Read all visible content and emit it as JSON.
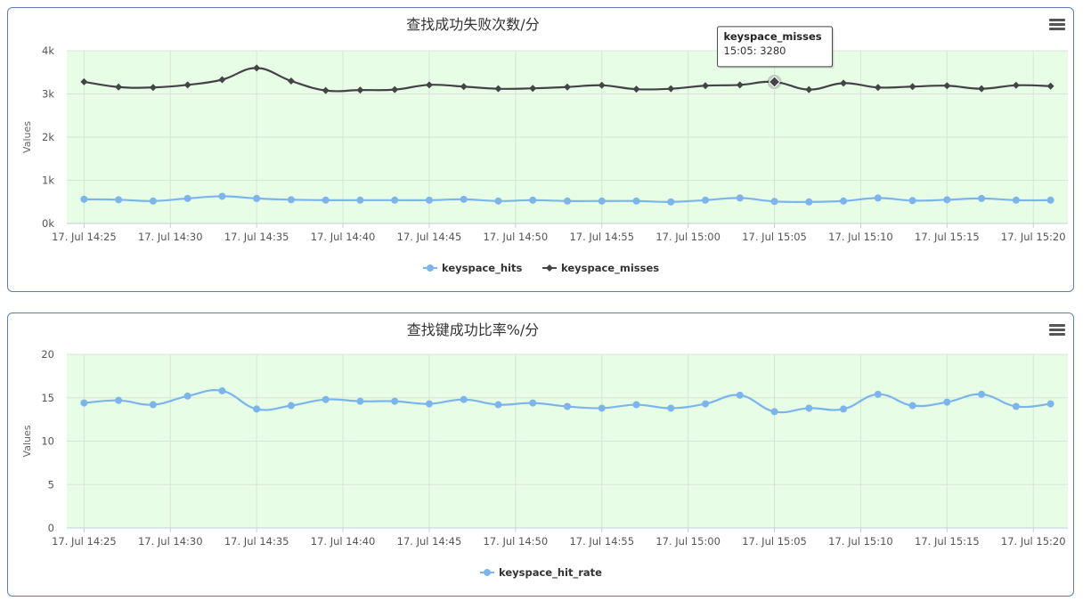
{
  "colors": {
    "hits": "#7cb5ec",
    "misses": "#434348",
    "plot_bg": "#e8fde6",
    "grid": "#d9e3d8"
  },
  "menu_icon": "hamburger-menu-icon",
  "chart_data": [
    {
      "type": "line",
      "title": "查找成功失败次数/分",
      "ylabel": "Values",
      "ylim": [
        0,
        4000
      ],
      "yticks": [
        "0k",
        "1k",
        "2k",
        "3k",
        "4k"
      ],
      "ytick_values": [
        0,
        1000,
        2000,
        3000,
        4000
      ],
      "xtick_labels": [
        "17. Jul 14:25",
        "17. Jul 14:30",
        "17. Jul 14:35",
        "17. Jul 14:40",
        "17. Jul 14:45",
        "17. Jul 14:50",
        "17. Jul 14:55",
        "17. Jul 15:00",
        "17. Jul 15:05",
        "17. Jul 15:10",
        "17. Jul 15:15",
        "17. Jul 15:20"
      ],
      "x": [
        "14:25",
        "14:27",
        "14:29",
        "14:31",
        "14:33",
        "14:35",
        "14:37",
        "14:39",
        "14:41",
        "14:43",
        "14:45",
        "14:47",
        "14:49",
        "14:51",
        "14:53",
        "14:55",
        "14:57",
        "14:59",
        "15:01",
        "15:03",
        "15:05",
        "15:07",
        "15:09",
        "15:11",
        "15:13",
        "15:15",
        "15:17",
        "15:19",
        "15:21"
      ],
      "legend_position": "bottom-center",
      "grid": true,
      "series": [
        {
          "name": "keyspace_hits",
          "marker": "circle",
          "values": [
            560,
            550,
            520,
            580,
            630,
            580,
            550,
            540,
            540,
            540,
            540,
            560,
            520,
            540,
            520,
            520,
            520,
            500,
            540,
            590,
            510,
            500,
            520,
            590,
            530,
            550,
            580,
            540,
            540
          ]
        },
        {
          "name": "keyspace_misses",
          "marker": "diamond",
          "values": [
            3280,
            3160,
            3150,
            3210,
            3330,
            3600,
            3300,
            3080,
            3090,
            3100,
            3210,
            3170,
            3120,
            3130,
            3160,
            3200,
            3110,
            3120,
            3190,
            3210,
            3280,
            3100,
            3250,
            3150,
            3170,
            3190,
            3120,
            3200,
            3180
          ]
        }
      ],
      "tooltip": {
        "series": "keyspace_misses",
        "text": "15:05: 3280"
      }
    },
    {
      "type": "line",
      "title": "查找键成功比率%/分",
      "ylabel": "Values",
      "ylim": [
        0,
        20
      ],
      "yticks": [
        "0",
        "5",
        "10",
        "15",
        "20"
      ],
      "ytick_values": [
        0,
        5,
        10,
        15,
        20
      ],
      "xtick_labels": [
        "17. Jul 14:25",
        "17. Jul 14:30",
        "17. Jul 14:35",
        "17. Jul 14:40",
        "17. Jul 14:45",
        "17. Jul 14:50",
        "17. Jul 14:55",
        "17. Jul 15:00",
        "17. Jul 15:05",
        "17. Jul 15:10",
        "17. Jul 15:15",
        "17. Jul 15:20"
      ],
      "x": [
        "14:25",
        "14:27",
        "14:29",
        "14:31",
        "14:33",
        "14:35",
        "14:37",
        "14:39",
        "14:41",
        "14:43",
        "14:45",
        "14:47",
        "14:49",
        "14:51",
        "14:53",
        "14:55",
        "14:57",
        "14:59",
        "15:01",
        "15:03",
        "15:05",
        "15:07",
        "15:09",
        "15:11",
        "15:13",
        "15:15",
        "15:17",
        "15:19",
        "15:21"
      ],
      "legend_position": "bottom-center",
      "grid": true,
      "series": [
        {
          "name": "keyspace_hit_rate",
          "marker": "circle",
          "values": [
            14.4,
            14.7,
            14.2,
            15.2,
            15.8,
            13.7,
            14.1,
            14.8,
            14.6,
            14.6,
            14.3,
            14.8,
            14.2,
            14.4,
            14.0,
            13.8,
            14.2,
            13.8,
            14.3,
            15.3,
            13.4,
            13.8,
            13.7,
            15.4,
            14.1,
            14.5,
            15.4,
            14.0,
            14.3
          ]
        }
      ]
    }
  ]
}
